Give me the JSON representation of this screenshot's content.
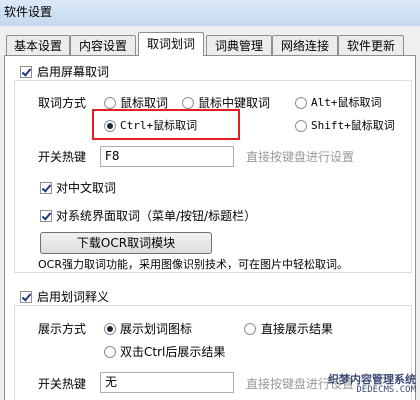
{
  "window": {
    "title": "软件设置"
  },
  "tabs": [
    {
      "label": "基本设置",
      "active": false
    },
    {
      "label": "内容设置",
      "active": false
    },
    {
      "label": "取词划词",
      "active": true
    },
    {
      "label": "词典管理",
      "active": false
    },
    {
      "label": "网络连接",
      "active": false
    },
    {
      "label": "软件更新",
      "active": false
    }
  ],
  "lookup": {
    "enable_label": "启用屏幕取词",
    "enable_checked": true,
    "method_label": "取词方式",
    "options": [
      {
        "label": "鼠标取词",
        "selected": false
      },
      {
        "label": "鼠标中键取词",
        "selected": false
      },
      {
        "label": "Alt+鼠标取词",
        "selected": false
      },
      {
        "label": "Ctrl+鼠标取词",
        "selected": true
      },
      {
        "label": "Shift+鼠标取词",
        "selected": false
      }
    ],
    "hotkey_label": "开关热键",
    "hotkey_value": "F8",
    "hotkey_hint": "直接按键盘进行设置",
    "chinese_label": "对中文取词",
    "chinese_checked": true,
    "sysui_label": "对系统界面取词（菜单/按钮/标题栏）",
    "sysui_checked": true,
    "ocr_button": "下载OCR取词模块",
    "ocr_desc": "OCR强力取词功能，采用图像识别技术，可在图片中轻松取词。"
  },
  "selection": {
    "enable_label": "启用划词释义",
    "enable_checked": true,
    "display_label": "展示方式",
    "options": [
      {
        "label": "展示划词图标",
        "selected": true
      },
      {
        "label": "直接展示结果",
        "selected": false
      },
      {
        "label": "双击Ctrl后展示结果",
        "selected": false
      }
    ],
    "hotkey_label": "开关热键",
    "hotkey_value": "无",
    "hotkey_hint": "直接按键盘进行设置"
  },
  "watermark": {
    "line1": "织梦内容管理系统",
    "line2": "DEDECMS.COM"
  }
}
